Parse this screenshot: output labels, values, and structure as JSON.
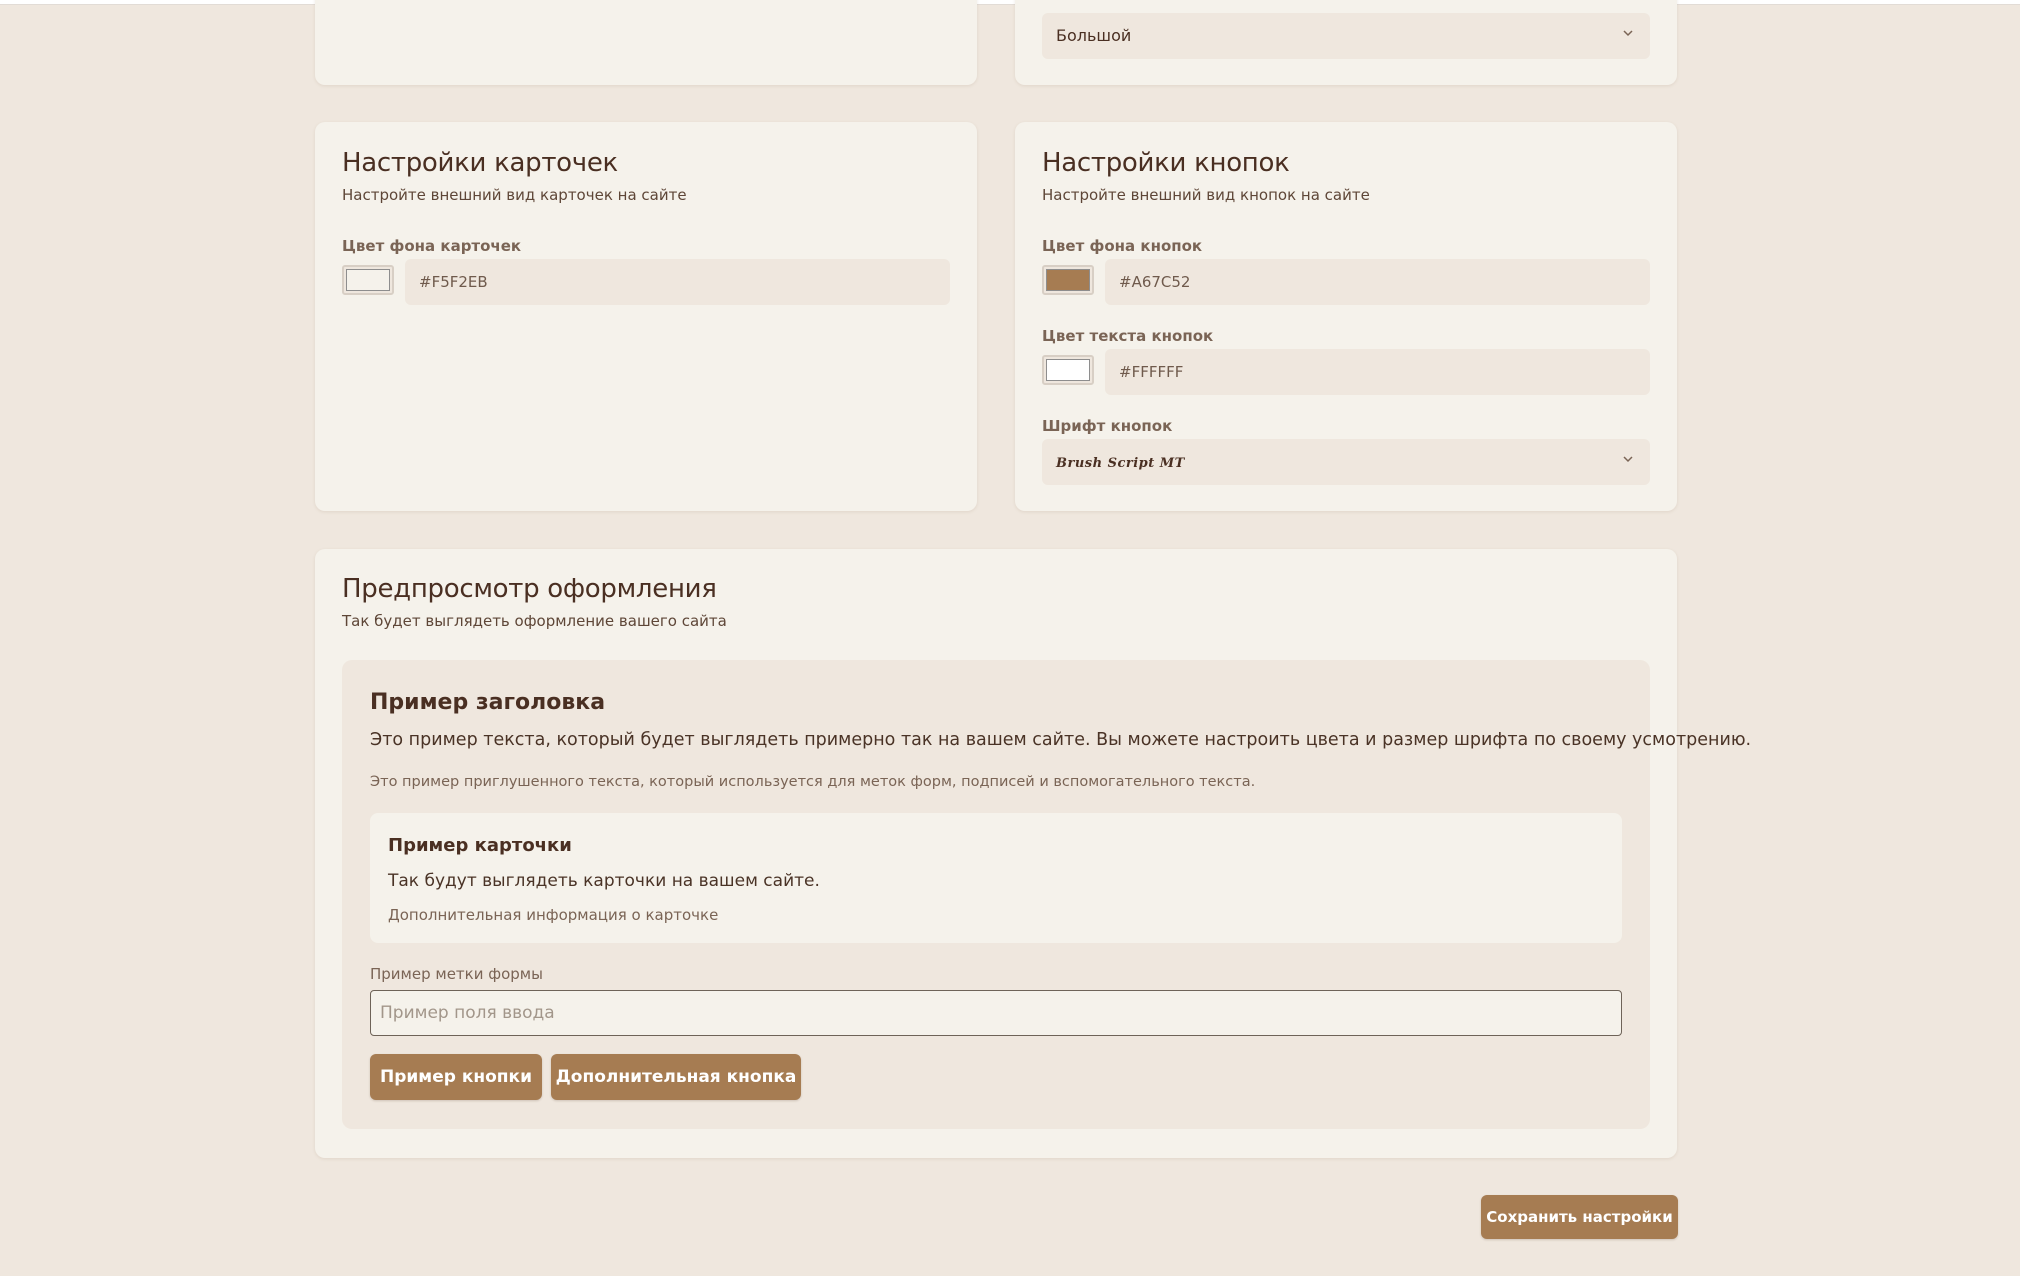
{
  "colors": {
    "page_bg": "#EFE7DE",
    "card_bg": "#F5F2EB",
    "accent": "#A67C52",
    "button_text": "#FFFFFF",
    "heading": "#4A2F22"
  },
  "top_card_right": {
    "font_size_select": {
      "value": "Большой",
      "icon": "chevron-down-icon"
    }
  },
  "card_settings": {
    "title": "Настройки карточек",
    "description": "Настройте внешний вид карточек на сайте",
    "bg_color_label": "Цвет фона карточек",
    "bg_color_value": "#F5F2EB"
  },
  "button_settings": {
    "title": "Настройки кнопок",
    "description": "Настройте внешний вид кнопок на сайте",
    "bg_color_label": "Цвет фона кнопок",
    "bg_color_value": "#A67C52",
    "text_color_label": "Цвет текста кнопок",
    "text_color_value": "#FFFFFF",
    "font_label": "Шрифт кнопок",
    "font_value": "Brush Script MT"
  },
  "preview": {
    "title": "Предпросмотр оформления",
    "description": "Так будет выглядеть оформление вашего сайта",
    "sample_heading": "Пример заголовка",
    "sample_text": "Это пример текста, который будет выглядеть примерно так на вашем сайте. Вы можете настроить цвета и размер шрифта по своему усмотрению.",
    "sample_muted": "Это пример приглушенного текста, который используется для меток форм, подписей и вспомогательного текста.",
    "sample_card": {
      "title": "Пример карточки",
      "text": "Так будут выглядеть карточки на вашем сайте.",
      "muted": "Дополнительная информация о карточке"
    },
    "form_label": "Пример метки формы",
    "input_placeholder": "Пример поля ввода",
    "primary_button": "Пример кнопки",
    "secondary_button": "Дополнительная кнопка"
  },
  "save_button": "Сохранить настройки"
}
